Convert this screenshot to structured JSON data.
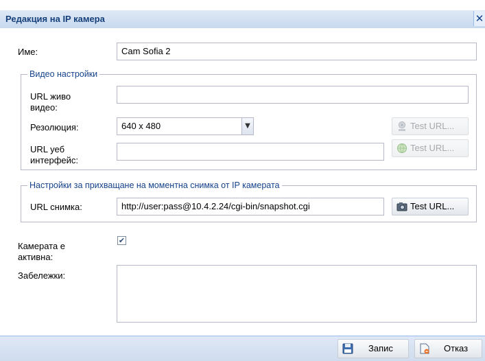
{
  "window": {
    "title": "Редакция на IP камера",
    "close_symbol": "✕"
  },
  "name": {
    "label": "Име:",
    "value": "Cam Sofia 2"
  },
  "video_settings": {
    "legend": "Видео настройки",
    "live_url": {
      "label_line1": "URL живо",
      "label_line2": "видео:",
      "value": ""
    },
    "resolution": {
      "label": "Резолюция:",
      "value": "640 x 480"
    },
    "web_url": {
      "label_line1": "URL уеб",
      "label_line2": "интерфейс:",
      "value": ""
    },
    "test_button_1": "Test URL...",
    "test_button_2": "Test URL..."
  },
  "snapshot_settings": {
    "legend": "Настройки за прихващане на моментна снимка от IP камерата",
    "snapshot_url": {
      "label": "URL снимка:",
      "value": "http://user:pass@10.4.2.24/cgi-bin/snapshot.cgi"
    },
    "test_button": "Test URL..."
  },
  "active": {
    "label_line1": "Камерата е",
    "label_line2": "активна:",
    "checked": true,
    "check_symbol": "✔"
  },
  "notes": {
    "label": "Забележки:",
    "value": ""
  },
  "footer": {
    "save_label": "Запис",
    "cancel_label": "Отказ"
  },
  "colors": {
    "title_text": "#16407a",
    "titlebar_bg": "#c7d8ee",
    "legend_text": "#15428b",
    "footer_bg": "#d5e2f2"
  },
  "icons": {
    "close": "close-icon",
    "combo": "chevron-down-icon",
    "camera": "camera-icon",
    "globe": "globe-icon",
    "webcam": "webcam-icon",
    "save": "floppy-disk-icon",
    "cancel": "cancel-document-icon"
  }
}
